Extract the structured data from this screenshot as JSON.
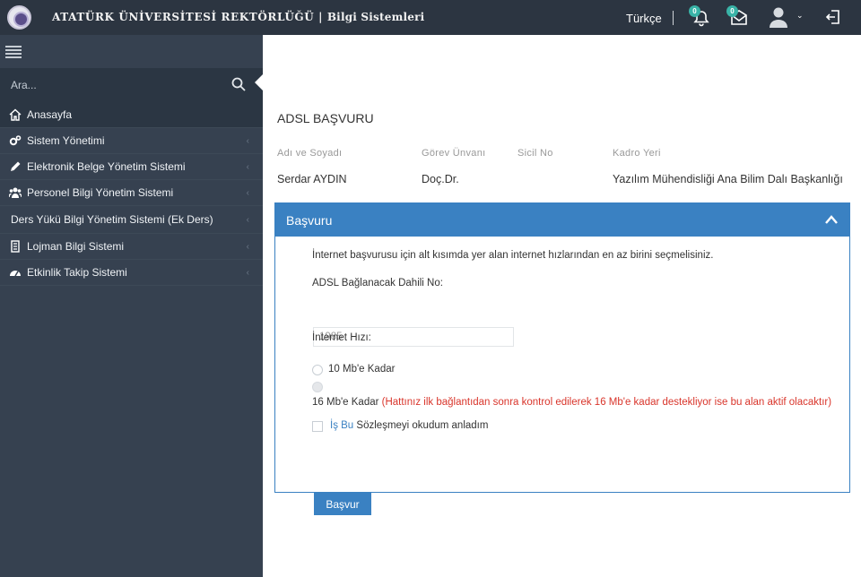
{
  "header": {
    "brand_main": "ATATÜRK ÜNİVERSİTESİ REKTÖRLÜĞÜ",
    "brand_sep": " | ",
    "brand_sub": "Bilgi Sistemleri",
    "language": "Türkçe",
    "notifications_count": "0",
    "messages_count": "0"
  },
  "sidebar": {
    "search_placeholder": "Ara...",
    "items": [
      {
        "label": "Anasayfa",
        "icon": "home-icon"
      },
      {
        "label": "Sistem Yönetimi",
        "icon": "cogs-icon"
      },
      {
        "label": "Elektronik Belge Yönetim Sistemi",
        "icon": "pencil-icon"
      },
      {
        "label": "Personel Bilgi Yönetim Sistemi",
        "icon": "users-icon"
      },
      {
        "label": "Ders Yükü Bilgi Yönetim Sistemi (Ek Ders)",
        "icon": ""
      },
      {
        "label": "Lojman Bilgi Sistemi",
        "icon": "building-icon"
      },
      {
        "label": "Etkinlik Takip Sistemi",
        "icon": "dashboard-icon"
      }
    ]
  },
  "main": {
    "title": "ADSL BAŞVURU",
    "info_headers": [
      "Adı ve Soyadı",
      "Görev Ünvanı",
      "Sicil No",
      "Kadro Yeri"
    ],
    "info_values": [
      "Serdar AYDIN",
      "Doç.Dr.",
      "",
      "Yazılım Mühendisliği Ana Bilim Dalı Başkanlığı"
    ]
  },
  "form": {
    "panel_title": "Başvuru",
    "instruction": "İnternet başvurusu için alt kısımda yer alan internet hızlarından en az birini seçmelisiniz.",
    "dahili_label": "ADSL Bağlanacak Dahili No:",
    "dahili_value": "1985",
    "speed_label": "İnternet Hızı:",
    "option1": "10 Mb'e Kadar",
    "option2": "16 Mb'e Kadar",
    "option2_note": "(Hattınız ilk bağlantıdan sonra kontrol edilerek 16 Mb'e kadar destekliyor ise bu alan aktif olacaktır)",
    "agreement_link": "İş Bu",
    "agreement_text": "Sözleşmeyi okudum anladım",
    "submit_label": "Başvur"
  },
  "colors": {
    "topbar": "#2c3541",
    "sidebar": "#364150",
    "primary": "#3a81c2",
    "note_red": "#d9352b"
  }
}
